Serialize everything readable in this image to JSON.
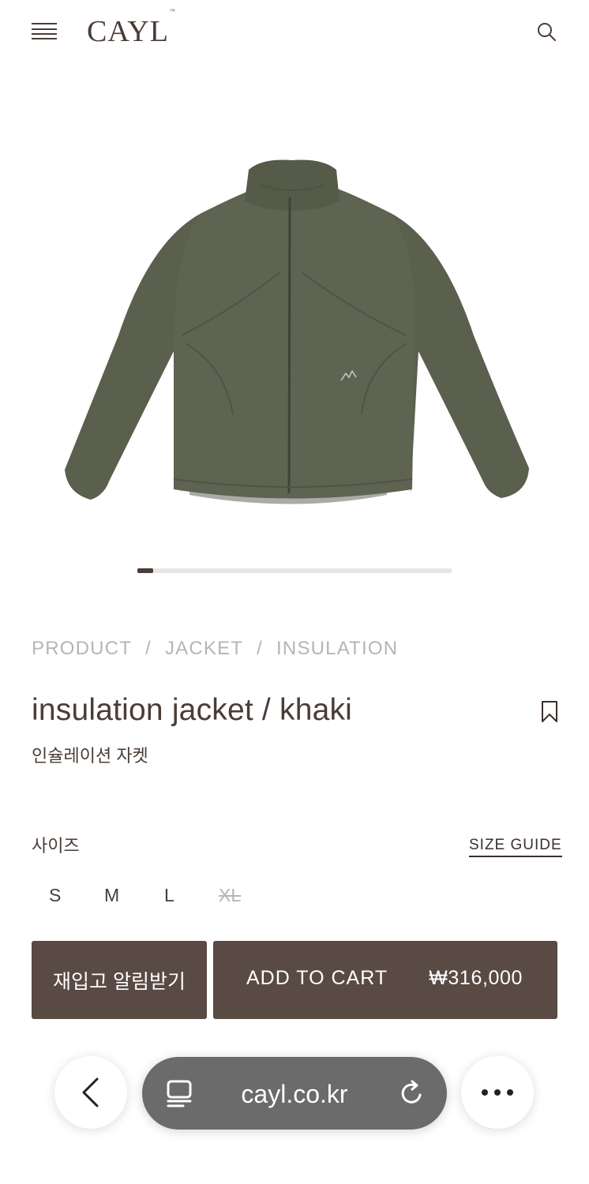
{
  "header": {
    "logo": "CAYL",
    "logo_mark": "™",
    "menu_icon": "hamburger-menu-icon",
    "search_icon": "search-icon"
  },
  "gallery": {
    "image_alt": "insulation jacket / khaki",
    "current_slide_fraction": 0.05
  },
  "breadcrumb": {
    "items": [
      "PRODUCT",
      "JACKET",
      "INSULATION"
    ],
    "separator": "/"
  },
  "product": {
    "title": "insulation jacket / khaki",
    "subtitle": "인슐레이션 자켓",
    "wishlist_icon": "bookmark-icon"
  },
  "size": {
    "label": "사이즈",
    "guide_label": "SIZE GUIDE",
    "options": [
      {
        "label": "S",
        "available": true
      },
      {
        "label": "M",
        "available": true
      },
      {
        "label": "L",
        "available": true
      },
      {
        "label": "XL",
        "available": false
      }
    ]
  },
  "actions": {
    "restock_label": "재입고 알림받기",
    "cart_label": "ADD TO CART",
    "price": "₩316,000"
  },
  "browser": {
    "url": "cayl.co.kr",
    "back_icon": "chevron-left-icon",
    "tabs_icon": "tab-layout-icon",
    "reload_icon": "reload-icon",
    "more_icon": "more-horizontal-icon"
  },
  "colors": {
    "brand": "#4a3c37",
    "button_bg": "#5a4a44",
    "muted_text": "#b9b4b1",
    "jacket": "#5c6150"
  }
}
